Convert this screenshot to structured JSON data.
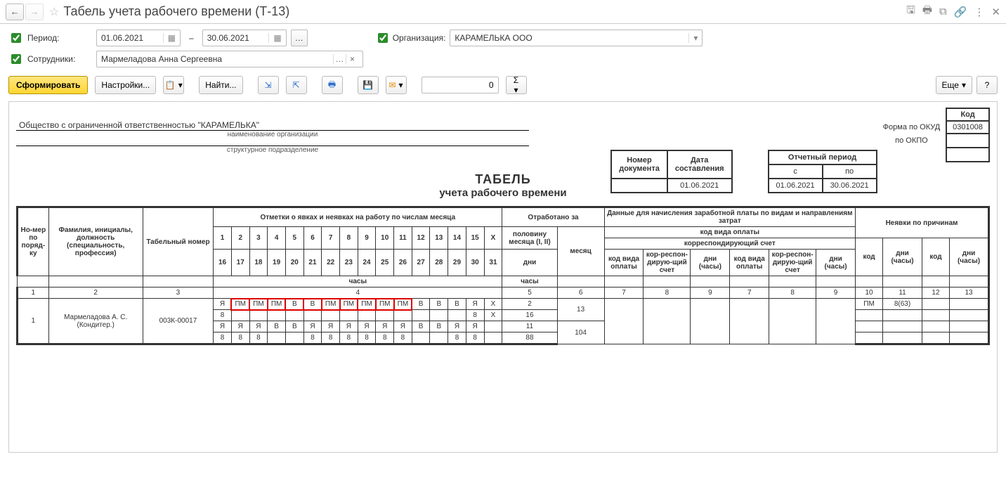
{
  "window": {
    "title": "Табель учета рабочего времени (Т-13)"
  },
  "filters": {
    "period_label": "Период:",
    "date_from": "01.06.2021",
    "date_to": "30.06.2021",
    "org_label": "Организация:",
    "org_value": "КАРАМЕЛЬКА ООО",
    "employees_label": "Сотрудники:",
    "employees_value": "Мармеладова Анна Сергеевна"
  },
  "toolbar": {
    "generate": "Сформировать",
    "settings": "Настройки...",
    "find": "Найти...",
    "num_value": "0",
    "more": "Еще"
  },
  "doc": {
    "org_name": "Общество с ограниченной ответственностью \"КАРАМЕЛЬКА\"",
    "org_caption": "наименование организации",
    "dept_caption": "структурное подразделение",
    "code_label": "Код",
    "okud_label": "Форма по ОКУД",
    "okud_value": "0301008",
    "okpo_label": "по ОКПО",
    "docnum_label1": "Номер",
    "docnum_label2": "документа",
    "docdate_label1": "Дата",
    "docdate_label2": "составления",
    "docdate_value": "01.06.2021",
    "period_label": "Отчетный период",
    "period_from_label": "с",
    "period_to_label": "по",
    "period_from": "01.06.2021",
    "period_to": "30.06.2021",
    "title": "ТАБЕЛЬ",
    "subtitle": "учета  рабочего времени"
  },
  "table": {
    "headers": {
      "num": "Но-мер по поряд-ку",
      "fio": "Фамилия, инициалы, должность (специальность, профессия)",
      "tabnum": "Табельный номер",
      "marks": "Отметки о явках и неявках на работу по числам месяца",
      "worked": "Отработано за",
      "payroll": "Данные для начисления заработной платы по видам и направлениям затрат",
      "payroll_code": "код вида оплаты",
      "payroll_acc": "корреспондирующий счет",
      "absence": "Неявки по причинам",
      "half": "половину месяца (I, II)",
      "month": "месяц",
      "days": "дни",
      "hours": "часы",
      "paycode": "код вида оплаты",
      "corracc": "кор-респон-дирую-щий счет",
      "dayhours": "дни (часы)",
      "code": "код"
    },
    "colnums": [
      "1",
      "2",
      "3",
      "4",
      "5",
      "6",
      "7",
      "8",
      "9",
      "7",
      "8",
      "9",
      "10",
      "11",
      "12",
      "13"
    ],
    "days_r1": [
      "1",
      "2",
      "3",
      "4",
      "5",
      "6",
      "7",
      "8",
      "9",
      "10",
      "11",
      "12",
      "13",
      "14",
      "15",
      "X"
    ],
    "days_r2": [
      "16",
      "17",
      "18",
      "19",
      "20",
      "21",
      "22",
      "23",
      "24",
      "25",
      "26",
      "27",
      "28",
      "29",
      "30",
      "31"
    ],
    "employee": {
      "num": "1",
      "name": "Мармеладова А. С. (Кондитер.)",
      "tabnum": "003К-00017",
      "row1_codes": [
        "Я",
        "ПМ",
        "ПМ",
        "ПМ",
        "В",
        "В",
        "ПМ",
        "ПМ",
        "ПМ",
        "ПМ",
        "ПМ",
        "В",
        "В",
        "В",
        "Я",
        "X"
      ],
      "row1_hours": [
        "8",
        "",
        "",
        "",
        "",
        "",
        "",
        "",
        "",
        "",
        "",
        "",
        "",
        "",
        "8",
        "X"
      ],
      "row2_codes": [
        "Я",
        "Я",
        "Я",
        "В",
        "В",
        "Я",
        "Я",
        "Я",
        "Я",
        "Я",
        "Я",
        "В",
        "В",
        "Я",
        "Я",
        ""
      ],
      "row2_hours": [
        "8",
        "8",
        "8",
        "",
        "",
        "8",
        "8",
        "8",
        "8",
        "8",
        "8",
        "",
        "",
        "8",
        "8",
        ""
      ],
      "half_days_1": "2",
      "half_hours_1": "16",
      "half_days_2": "11",
      "half_hours_2": "88",
      "month_days": "13",
      "month_hours": "104",
      "absence_code": "ПМ",
      "absence_val": "8(63)"
    }
  }
}
